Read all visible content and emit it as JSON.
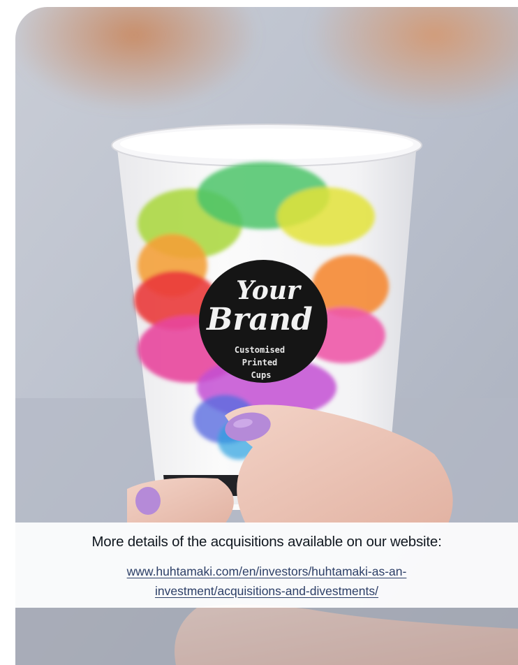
{
  "logo": {
    "line1": "Your",
    "line2": "Brand",
    "sub1": "Customised",
    "sub2": "Printed",
    "sub3": "Cups"
  },
  "caption": {
    "heading": "More details of the acquisitions available on our website:",
    "link_line1": "www.huhtamaki.com/en/investors/huhtamaki-as-an-",
    "link_line2": "investment/acquisitions-and-divestments/"
  },
  "colors": {
    "caption_text": "#111820",
    "link": "#2c3e66",
    "nail_polish": "#b58ad8",
    "logo_badge": "#141414"
  }
}
